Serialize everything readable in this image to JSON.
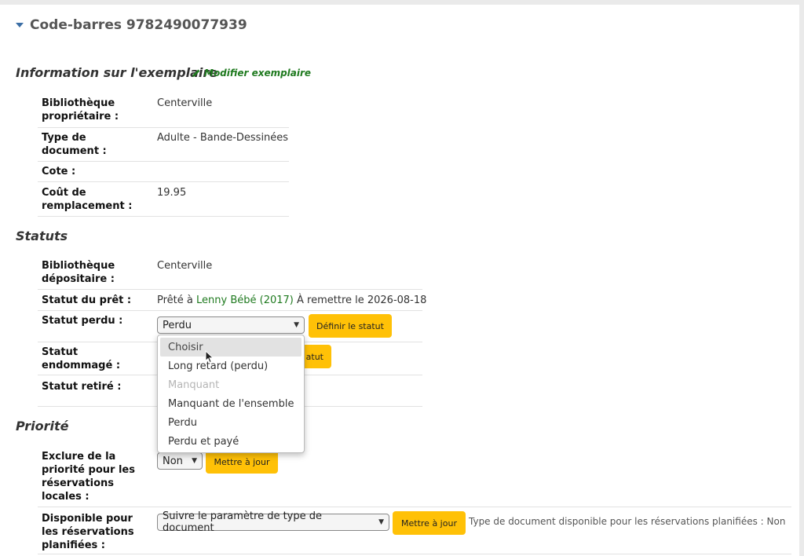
{
  "item": {
    "barcode_heading": "Code-barres 9782490077939"
  },
  "info": {
    "title": "Information sur l'exemplaire",
    "edit_label": "Modifier exemplaire",
    "rows": [
      {
        "label_l1": "Bibliothèque",
        "label_l2": "propriétaire :",
        "value": "Centerville"
      },
      {
        "label_l1": "Type de",
        "label_l2": "document :",
        "value": "Adulte - Bande-Dessinées"
      },
      {
        "label_l1": "Cote :",
        "value": ""
      },
      {
        "label_l1": "Coût de",
        "label_l2": "remplacement :",
        "value": "19.95"
      }
    ]
  },
  "statuses": {
    "title": "Statuts",
    "holding": {
      "label_l1": "Bibliothèque",
      "label_l2": "dépositaire :",
      "value": "Centerville"
    },
    "checkout": {
      "label": "Statut du prêt :",
      "prefix": "Prêté à",
      "patron": "Lenny Bébé (2017)",
      "suffix": "À remettre le 2026-08-18"
    },
    "lost": {
      "label": "Statut perdu :",
      "selected": "Perdu",
      "button": "Définir le statut"
    },
    "damaged": {
      "label_l1": "Statut",
      "label_l2": "endommagé :",
      "button_partial": "atut"
    },
    "withdrawn": {
      "label": "Statut retiré :"
    },
    "lost_options": [
      "Choisir",
      "Long retard (perdu)",
      "Manquant",
      "Manquant de l'ensemble",
      "Perdu",
      "Perdu et payé"
    ]
  },
  "priority": {
    "title": "Priorité",
    "exclude": {
      "label_l1": "Exclure de la",
      "label_l2": "priorité pour les",
      "label_l3": "réservations",
      "label_l4": "locales :",
      "selected": "Non",
      "button": "Mettre à jour"
    },
    "available": {
      "label_l1": "Disponible pour",
      "label_l2": "les réservations",
      "label_l3": "planifiées :",
      "selected": "Suivre le paramètre de type de document",
      "button": "Mettre à jour",
      "note": "Type de document disponible pour les réservations planifiées : Non"
    }
  },
  "colors": {
    "accent": "#ffc107",
    "link": "#1f7a1f",
    "caret": "#3b6ea5"
  },
  "icons": [
    "caret-down-icon",
    "pencil-icon",
    "chevron-down-icon",
    "mouse-cursor-icon"
  ]
}
